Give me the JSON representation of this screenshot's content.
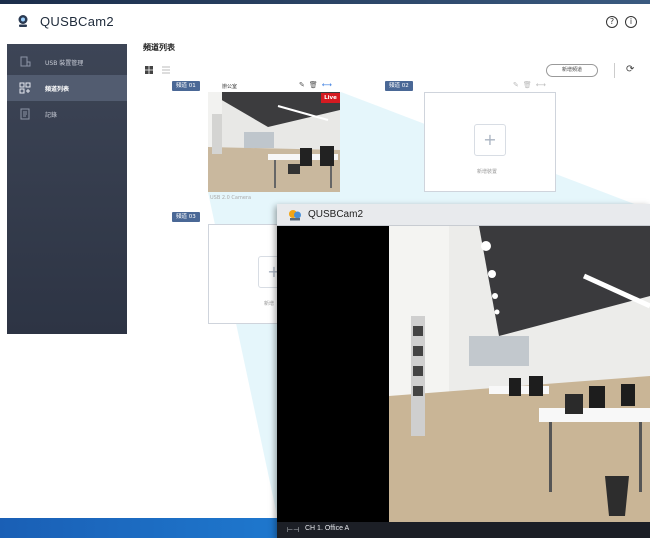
{
  "app": {
    "title": "QUSBCam2"
  },
  "header": {
    "help_icon": "question-circle-icon",
    "info_icon": "info-circle-icon"
  },
  "sidebar": {
    "items": [
      {
        "label": "USB 裝置管理",
        "icon": "usb-device-icon"
      },
      {
        "label": "頻道列表",
        "icon": "channel-list-icon",
        "active": true
      },
      {
        "label": "記錄",
        "icon": "log-icon"
      }
    ]
  },
  "main": {
    "title": "頻道列表",
    "add_channel_label": "新增頻道",
    "channels": [
      {
        "badge": "頻道 01",
        "name": "辦公室",
        "caption": "USB 2.0 Camera",
        "live": "Live"
      },
      {
        "badge": "頻道 02",
        "add_label": "新增裝置"
      },
      {
        "badge": "頻道 03",
        "add_label": "新增"
      }
    ]
  },
  "viewer": {
    "title": "QUSBCam2",
    "status": "CH 1. Office A"
  },
  "colors": {
    "accent": "#4a6896",
    "live": "#d51a21",
    "sidebar": "#3d4556",
    "taskbar": "#1e76cc"
  }
}
